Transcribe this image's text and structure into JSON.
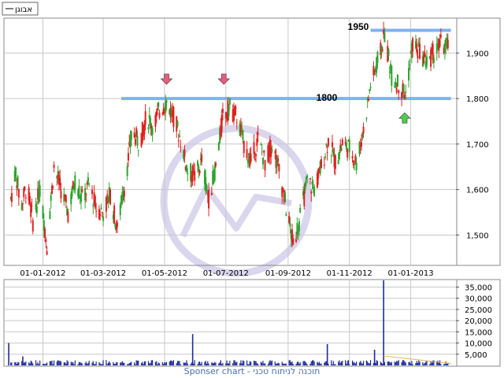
{
  "legend": {
    "label": "אבוגן"
  },
  "footer": {
    "text": "Sponser chart - תוכנה לניתוח טכני"
  },
  "annotations": {
    "level_high": "1950",
    "level_low": "1800"
  },
  "colors": {
    "up": "#2ea32e",
    "down": "#e02020",
    "level_line": "#7fb2f0",
    "volume": "#1f2a9a",
    "volume_avg": "#e8b35a",
    "grid": "#c8c8c8",
    "watermark": "#d9d6ee"
  },
  "chart_data": [
    {
      "type": "candlestick",
      "title": "",
      "x_tick_labels": [
        "01-01-2012",
        "01-03-2012",
        "01-05-2012",
        "01-07-2012",
        "01-09-2012",
        "01-11-2012",
        "01-01-2013"
      ],
      "x_tick_dates": [
        "2012-01-01",
        "2012-03-01",
        "2012-05-01",
        "2012-07-01",
        "2012-09-01",
        "2012-11-01",
        "2013-01-01"
      ],
      "xlim": [
        "2011-11-24",
        "2013-02-15"
      ],
      "y_tick_labels": [
        "1,500",
        "1,600",
        "1,700",
        "1,800",
        "1,900"
      ],
      "y_ticks": [
        1500,
        1600,
        1700,
        1800,
        1900
      ],
      "ylim": [
        1435,
        1975
      ],
      "horizontal_levels": [
        {
          "value": 1950,
          "from": "2012-11-22",
          "to": "2013-02-10"
        },
        {
          "value": 1800,
          "from": "2012-03-19",
          "to": "2013-02-10"
        }
      ],
      "markers": [
        {
          "type": "arrow-down",
          "date": "2012-05-03",
          "value": 1840,
          "color": "#f05a7a"
        },
        {
          "type": "arrow-down",
          "date": "2012-06-29",
          "value": 1840,
          "color": "#f05a7a"
        },
        {
          "type": "arrow-up",
          "date": "2012-12-26",
          "value": 1760,
          "color": "#49d14b"
        }
      ],
      "close_path": [
        [
          "2011-11-30",
          1580
        ],
        [
          "2011-12-05",
          1640
        ],
        [
          "2011-12-10",
          1560
        ],
        [
          "2011-12-16",
          1610
        ],
        [
          "2011-12-22",
          1530
        ],
        [
          "2011-12-29",
          1600
        ],
        [
          "2012-01-05",
          1480
        ],
        [
          "2012-01-12",
          1650
        ],
        [
          "2012-01-19",
          1600
        ],
        [
          "2012-01-26",
          1550
        ],
        [
          "2012-02-02",
          1620
        ],
        [
          "2012-02-09",
          1580
        ],
        [
          "2012-02-16",
          1610
        ],
        [
          "2012-02-23",
          1560
        ],
        [
          "2012-03-01",
          1550
        ],
        [
          "2012-03-08",
          1590
        ],
        [
          "2012-03-15",
          1510
        ],
        [
          "2012-03-19",
          1570
        ],
        [
          "2012-03-23",
          1620
        ],
        [
          "2012-03-30",
          1730
        ],
        [
          "2012-04-06",
          1700
        ],
        [
          "2012-04-13",
          1760
        ],
        [
          "2012-04-20",
          1740
        ],
        [
          "2012-04-27",
          1780
        ],
        [
          "2012-05-03",
          1790
        ],
        [
          "2012-05-10",
          1760
        ],
        [
          "2012-05-17",
          1710
        ],
        [
          "2012-05-24",
          1640
        ],
        [
          "2012-05-31",
          1630
        ],
        [
          "2012-06-07",
          1660
        ],
        [
          "2012-06-14",
          1580
        ],
        [
          "2012-06-21",
          1650
        ],
        [
          "2012-06-28",
          1760
        ],
        [
          "2012-07-05",
          1780
        ],
        [
          "2012-07-12",
          1760
        ],
        [
          "2012-07-19",
          1700
        ],
        [
          "2012-07-26",
          1660
        ],
        [
          "2012-08-02",
          1710
        ],
        [
          "2012-08-09",
          1660
        ],
        [
          "2012-08-16",
          1700
        ],
        [
          "2012-08-23",
          1640
        ],
        [
          "2012-08-30",
          1560
        ],
        [
          "2012-09-06",
          1480
        ],
        [
          "2012-09-13",
          1540
        ],
        [
          "2012-09-20",
          1620
        ],
        [
          "2012-09-27",
          1600
        ],
        [
          "2012-10-04",
          1650
        ],
        [
          "2012-10-11",
          1710
        ],
        [
          "2012-10-18",
          1660
        ],
        [
          "2012-10-25",
          1700
        ],
        [
          "2012-11-01",
          1690
        ],
        [
          "2012-11-08",
          1660
        ],
        [
          "2012-11-15",
          1730
        ],
        [
          "2012-11-22",
          1830
        ],
        [
          "2012-11-29",
          1880
        ],
        [
          "2012-12-06",
          1940
        ],
        [
          "2012-12-13",
          1850
        ],
        [
          "2012-12-20",
          1830
        ],
        [
          "2012-12-27",
          1810
        ],
        [
          "2013-01-03",
          1920
        ],
        [
          "2013-01-10",
          1900
        ],
        [
          "2013-01-17",
          1880
        ],
        [
          "2013-01-24",
          1900
        ],
        [
          "2013-01-31",
          1920
        ],
        [
          "2013-02-07",
          1910
        ]
      ]
    },
    {
      "type": "bar",
      "title": "",
      "y_tick_labels": [
        "5,000",
        "10,000",
        "15,000",
        "20,000",
        "25,000",
        "30,000",
        "35,000"
      ],
      "y_ticks": [
        5000,
        10000,
        15000,
        20000,
        25000,
        30000,
        35000
      ],
      "ylim": [
        0,
        38000
      ],
      "spikes": [
        {
          "date": "2011-11-28",
          "value": 10000
        },
        {
          "date": "2011-12-12",
          "value": 4000
        },
        {
          "date": "2012-05-29",
          "value": 14000
        },
        {
          "date": "2012-10-10",
          "value": 9500
        },
        {
          "date": "2012-12-05",
          "value": 38000
        },
        {
          "date": "2012-11-26",
          "value": 7000
        }
      ],
      "baseline_volume": 1200,
      "avg_line": [
        [
          "2012-12-05",
          4200
        ],
        [
          "2013-02-10",
          900
        ]
      ]
    }
  ]
}
